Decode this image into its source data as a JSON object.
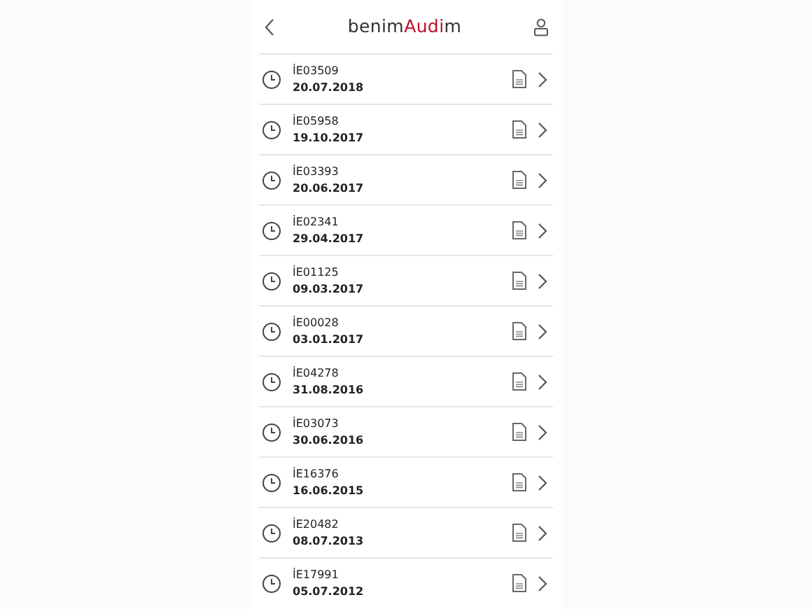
{
  "header": {
    "logo": [
      {
        "text": "benim",
        "accent": false
      },
      {
        "text": "Audi",
        "accent": true
      },
      {
        "text": "m",
        "accent": false
      }
    ]
  },
  "records": [
    {
      "code": "İE03509",
      "date": "20.07.2018"
    },
    {
      "code": "İE05958",
      "date": "19.10.2017"
    },
    {
      "code": "İE03393",
      "date": "20.06.2017"
    },
    {
      "code": "İE02341",
      "date": "29.04.2017"
    },
    {
      "code": "İE01125",
      "date": "09.03.2017"
    },
    {
      "code": "İE00028",
      "date": "03.01.2017"
    },
    {
      "code": "İE04278",
      "date": "31.08.2016"
    },
    {
      "code": "İE03073",
      "date": "30.06.2016"
    },
    {
      "code": "İE16376",
      "date": "16.06.2015"
    },
    {
      "code": "İE20482",
      "date": "08.07.2013"
    },
    {
      "code": "İE17991",
      "date": "05.07.2012"
    }
  ]
}
